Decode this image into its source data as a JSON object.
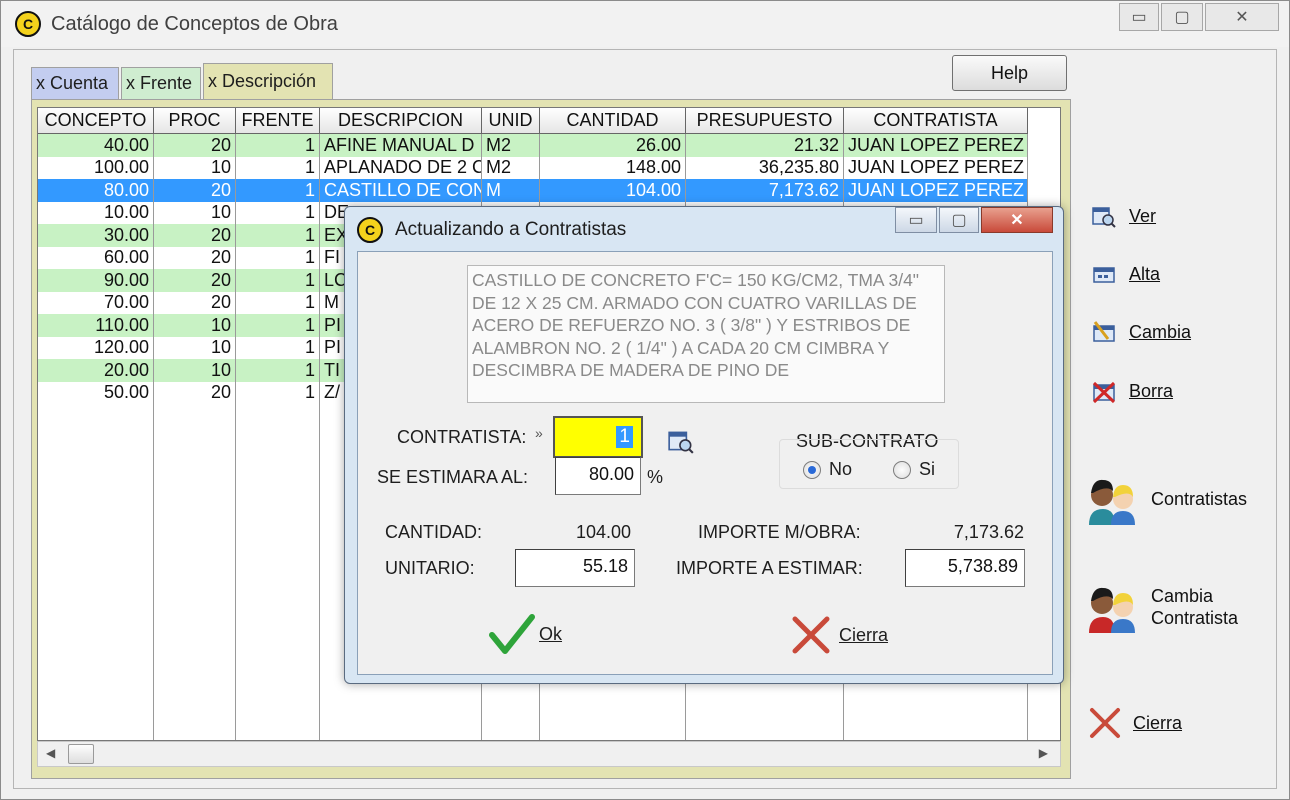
{
  "window": {
    "title": "Catálogo de Conceptos de Obra",
    "min_glyph": "▭",
    "max_glyph": "▢",
    "close_glyph": "✕"
  },
  "tabs": [
    {
      "label": "x Cuenta"
    },
    {
      "label": "x Frente"
    },
    {
      "label": "x Descripción"
    }
  ],
  "help_label": "Help",
  "grid": {
    "headers": [
      "CONCEPTO",
      "PROC",
      "FRENTE",
      "DESCRIPCION",
      "UNID",
      "CANTIDAD",
      "PRESUPUESTO",
      "CONTRATISTA"
    ],
    "rows": [
      {
        "concepto": "40.00",
        "proc": "20",
        "frente": "1",
        "descripcion": "AFINE MANUAL D",
        "unid": "M2",
        "cantidad": "26.00",
        "presupuesto": "21.32",
        "contratista": "JUAN LOPEZ PEREZ",
        "style": "green"
      },
      {
        "concepto": "100.00",
        "proc": "10",
        "frente": "1",
        "descripcion": "APLANADO DE 2 C",
        "unid": "M2",
        "cantidad": "148.00",
        "presupuesto": "36,235.80",
        "contratista": "JUAN LOPEZ PEREZ",
        "style": "white"
      },
      {
        "concepto": "80.00",
        "proc": "20",
        "frente": "1",
        "descripcion": "CASTILLO DE CON",
        "unid": "M",
        "cantidad": "104.00",
        "presupuesto": "7,173.62",
        "contratista": "JUAN LOPEZ PEREZ",
        "style": "sel"
      },
      {
        "concepto": "10.00",
        "proc": "10",
        "frente": "1",
        "descripcion": "DE",
        "unid": "",
        "cantidad": "",
        "presupuesto": "",
        "contratista": "",
        "style": "white"
      },
      {
        "concepto": "30.00",
        "proc": "20",
        "frente": "1",
        "descripcion": "EX",
        "unid": "",
        "cantidad": "",
        "presupuesto": "",
        "contratista": "",
        "style": "green"
      },
      {
        "concepto": "60.00",
        "proc": "20",
        "frente": "1",
        "descripcion": "FI",
        "unid": "",
        "cantidad": "",
        "presupuesto": "",
        "contratista": "",
        "style": "white"
      },
      {
        "concepto": "90.00",
        "proc": "20",
        "frente": "1",
        "descripcion": "LC",
        "unid": "",
        "cantidad": "",
        "presupuesto": "",
        "contratista": "",
        "style": "green"
      },
      {
        "concepto": "70.00",
        "proc": "20",
        "frente": "1",
        "descripcion": "M",
        "unid": "",
        "cantidad": "",
        "presupuesto": "",
        "contratista": "",
        "style": "white"
      },
      {
        "concepto": "110.00",
        "proc": "10",
        "frente": "1",
        "descripcion": "PI",
        "unid": "",
        "cantidad": "",
        "presupuesto": "",
        "contratista": "",
        "style": "green"
      },
      {
        "concepto": "120.00",
        "proc": "10",
        "frente": "1",
        "descripcion": "PI",
        "unid": "",
        "cantidad": "",
        "presupuesto": "",
        "contratista": "",
        "style": "white"
      },
      {
        "concepto": "20.00",
        "proc": "10",
        "frente": "1",
        "descripcion": "TI",
        "unid": "",
        "cantidad": "",
        "presupuesto": "",
        "contratista": "",
        "style": "green"
      },
      {
        "concepto": "50.00",
        "proc": "20",
        "frente": "1",
        "descripcion": "Z/",
        "unid": "",
        "cantidad": "",
        "presupuesto": "",
        "contratista": "",
        "style": "white"
      }
    ]
  },
  "side_buttons": [
    {
      "label": "Ver",
      "icon": "view-icon"
    },
    {
      "label": "Alta",
      "icon": "add-icon"
    },
    {
      "label": "Cambia",
      "icon": "edit-icon"
    },
    {
      "label": "Borra",
      "icon": "delete-icon"
    },
    {
      "label": "Contratistas",
      "icon": "people-icon"
    },
    {
      "label": "Cambia",
      "label2": "Contratista",
      "icon": "people-change-icon"
    },
    {
      "label": "Cierra",
      "icon": "close-x-icon"
    }
  ],
  "dialog": {
    "title": "Actualizando a Contratistas",
    "description": "CASTILLO DE CONCRETO F'C= 150 KG/CM2, TMA 3/4\" DE 12 X 25 CM. ARMADO CON CUATRO VARILLAS DE ACERO DE REFUERZO NO. 3 ( 3/8\" ) Y ESTRIBOS DE ALAMBRON NO. 2 ( 1/4\" ) A CADA 20 CM CIMBRA Y DESCIMBRA DE MADERA DE PINO DE",
    "contratista_label": "CONTRATISTA:",
    "contratista_value": "1",
    "se_estimara_label": "SE ESTIMARA AL:",
    "se_estimara_value": "80.00",
    "percent_sign": "%",
    "subcontrato_label": "SUB-CONTRATO",
    "radio_no": "No",
    "radio_si": "Si",
    "cantidad_label": "CANTIDAD:",
    "cantidad_value": "104.00",
    "importe_mobra_label": "IMPORTE M/OBRA:",
    "importe_mobra_value": "7,173.62",
    "unitario_label": "UNITARIO:",
    "unitario_value": "55.18",
    "importe_estimar_label": "IMPORTE A ESTIMAR:",
    "importe_estimar_value": "5,738.89",
    "ok_label": "Ok",
    "cierra_label": "Cierra"
  },
  "colors": {
    "row_green": "#c8f2c4",
    "row_selected": "#3399ff",
    "tab_cuenta": "#c3cdf0",
    "tab_frente": "#cfedd0",
    "tab_descripcion": "#e3e3b2",
    "close_red": "#c94a3a"
  }
}
